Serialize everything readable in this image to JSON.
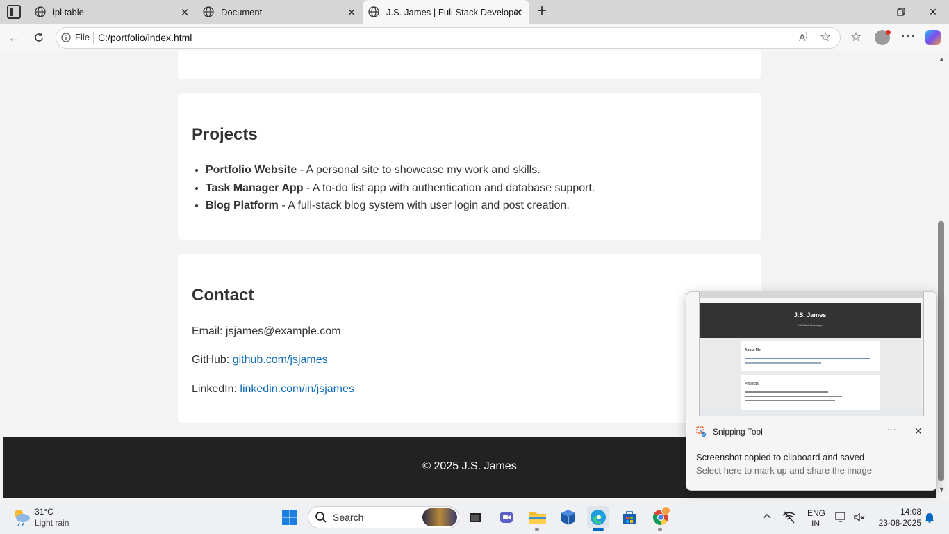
{
  "browser": {
    "tabs": [
      {
        "title": "ipl table",
        "active": false
      },
      {
        "title": "Document",
        "active": false
      },
      {
        "title": "J.S. James | Full Stack Developer",
        "active": true
      }
    ],
    "address": {
      "scheme_label": "File",
      "url": "C:/portfolio/index.html"
    }
  },
  "page": {
    "projects": {
      "heading": "Projects",
      "items": [
        {
          "name": "Portfolio Website",
          "desc": " - A personal site to showcase my work and skills."
        },
        {
          "name": "Task Manager App",
          "desc": " - A to-do list app with authentication and database support."
        },
        {
          "name": "Blog Platform",
          "desc": " - A full-stack blog system with user login and post creation."
        }
      ]
    },
    "contact": {
      "heading": "Contact",
      "email_label": "Email: ",
      "email_value": "jsjames@example.com",
      "github_label": "GitHub: ",
      "github_link": "github.com/jsjames",
      "linkedin_label": "LinkedIn: ",
      "linkedin_link": "linkedin.com/in/jsjames"
    },
    "footer": "© 2025 J.S. James"
  },
  "toast": {
    "app": "Snipping Tool",
    "title": "Screenshot copied to clipboard and saved",
    "subtitle": "Select here to mark up and share the image",
    "preview": {
      "name": "J.S. James",
      "tagline": "Full Stack Developer",
      "about_heading": "About Me",
      "projects_heading": "Projects"
    }
  },
  "taskbar": {
    "weather_temp": "31°C",
    "weather_desc": "Light rain",
    "search_placeholder": "Search",
    "lang_top": "ENG",
    "lang_bottom": "IN",
    "time": "14:08",
    "date": "23-08-2025"
  },
  "colors": {
    "link": "#0e6bb8",
    "footer_bg": "#222222",
    "accent_edge": "#0067c0"
  }
}
